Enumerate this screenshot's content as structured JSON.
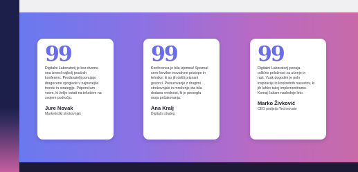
{
  "testimonials": [
    {
      "quote_mark": "99",
      "text": "Digitalni Laboratorij je bez dvoma\nena izmed najbolj poučnih\nkonferenc. Predavatelji ponujajo\ndragocene vpoglede v najnovejše\ntrende in strategije. Priporočam\nvsem, ki želijo ostati na tekočem na\nsvojem področju.",
      "author": "Jure Novak",
      "role": "Marketinški strokovnjak"
    },
    {
      "quote_mark": "99",
      "text": "Konferenca je bila izjemna! Spoznal\nsem številne inovativne pristope in\ntehnike, ki so jih delili priznani\ngovorci. Povezovanje z drugimi\nstrokovnjaki in mreženje sta bila\ndodana vrednost, ki je presegla\nmoja pričakovanja.",
      "author": "Ana Kralj",
      "role": "Digitalni strateg"
    },
    {
      "quote_mark": "99",
      "text": "Digitalni Laboratorij ponuja\nodlično priložnost za učenje in\nrast. Vsak dogodek je poln\ninspiracije in konkretnih nasvetov, ki\njih lahko takoj implementiramo.\nKomaj čakam naslednje leto.",
      "author": "Marko Živković",
      "role": "CEO podjetja Technovate"
    }
  ],
  "colors": {
    "quote_accent": "#6a6de8",
    "gradient_left": "#6a79ef",
    "gradient_right": "#c86aa8"
  }
}
